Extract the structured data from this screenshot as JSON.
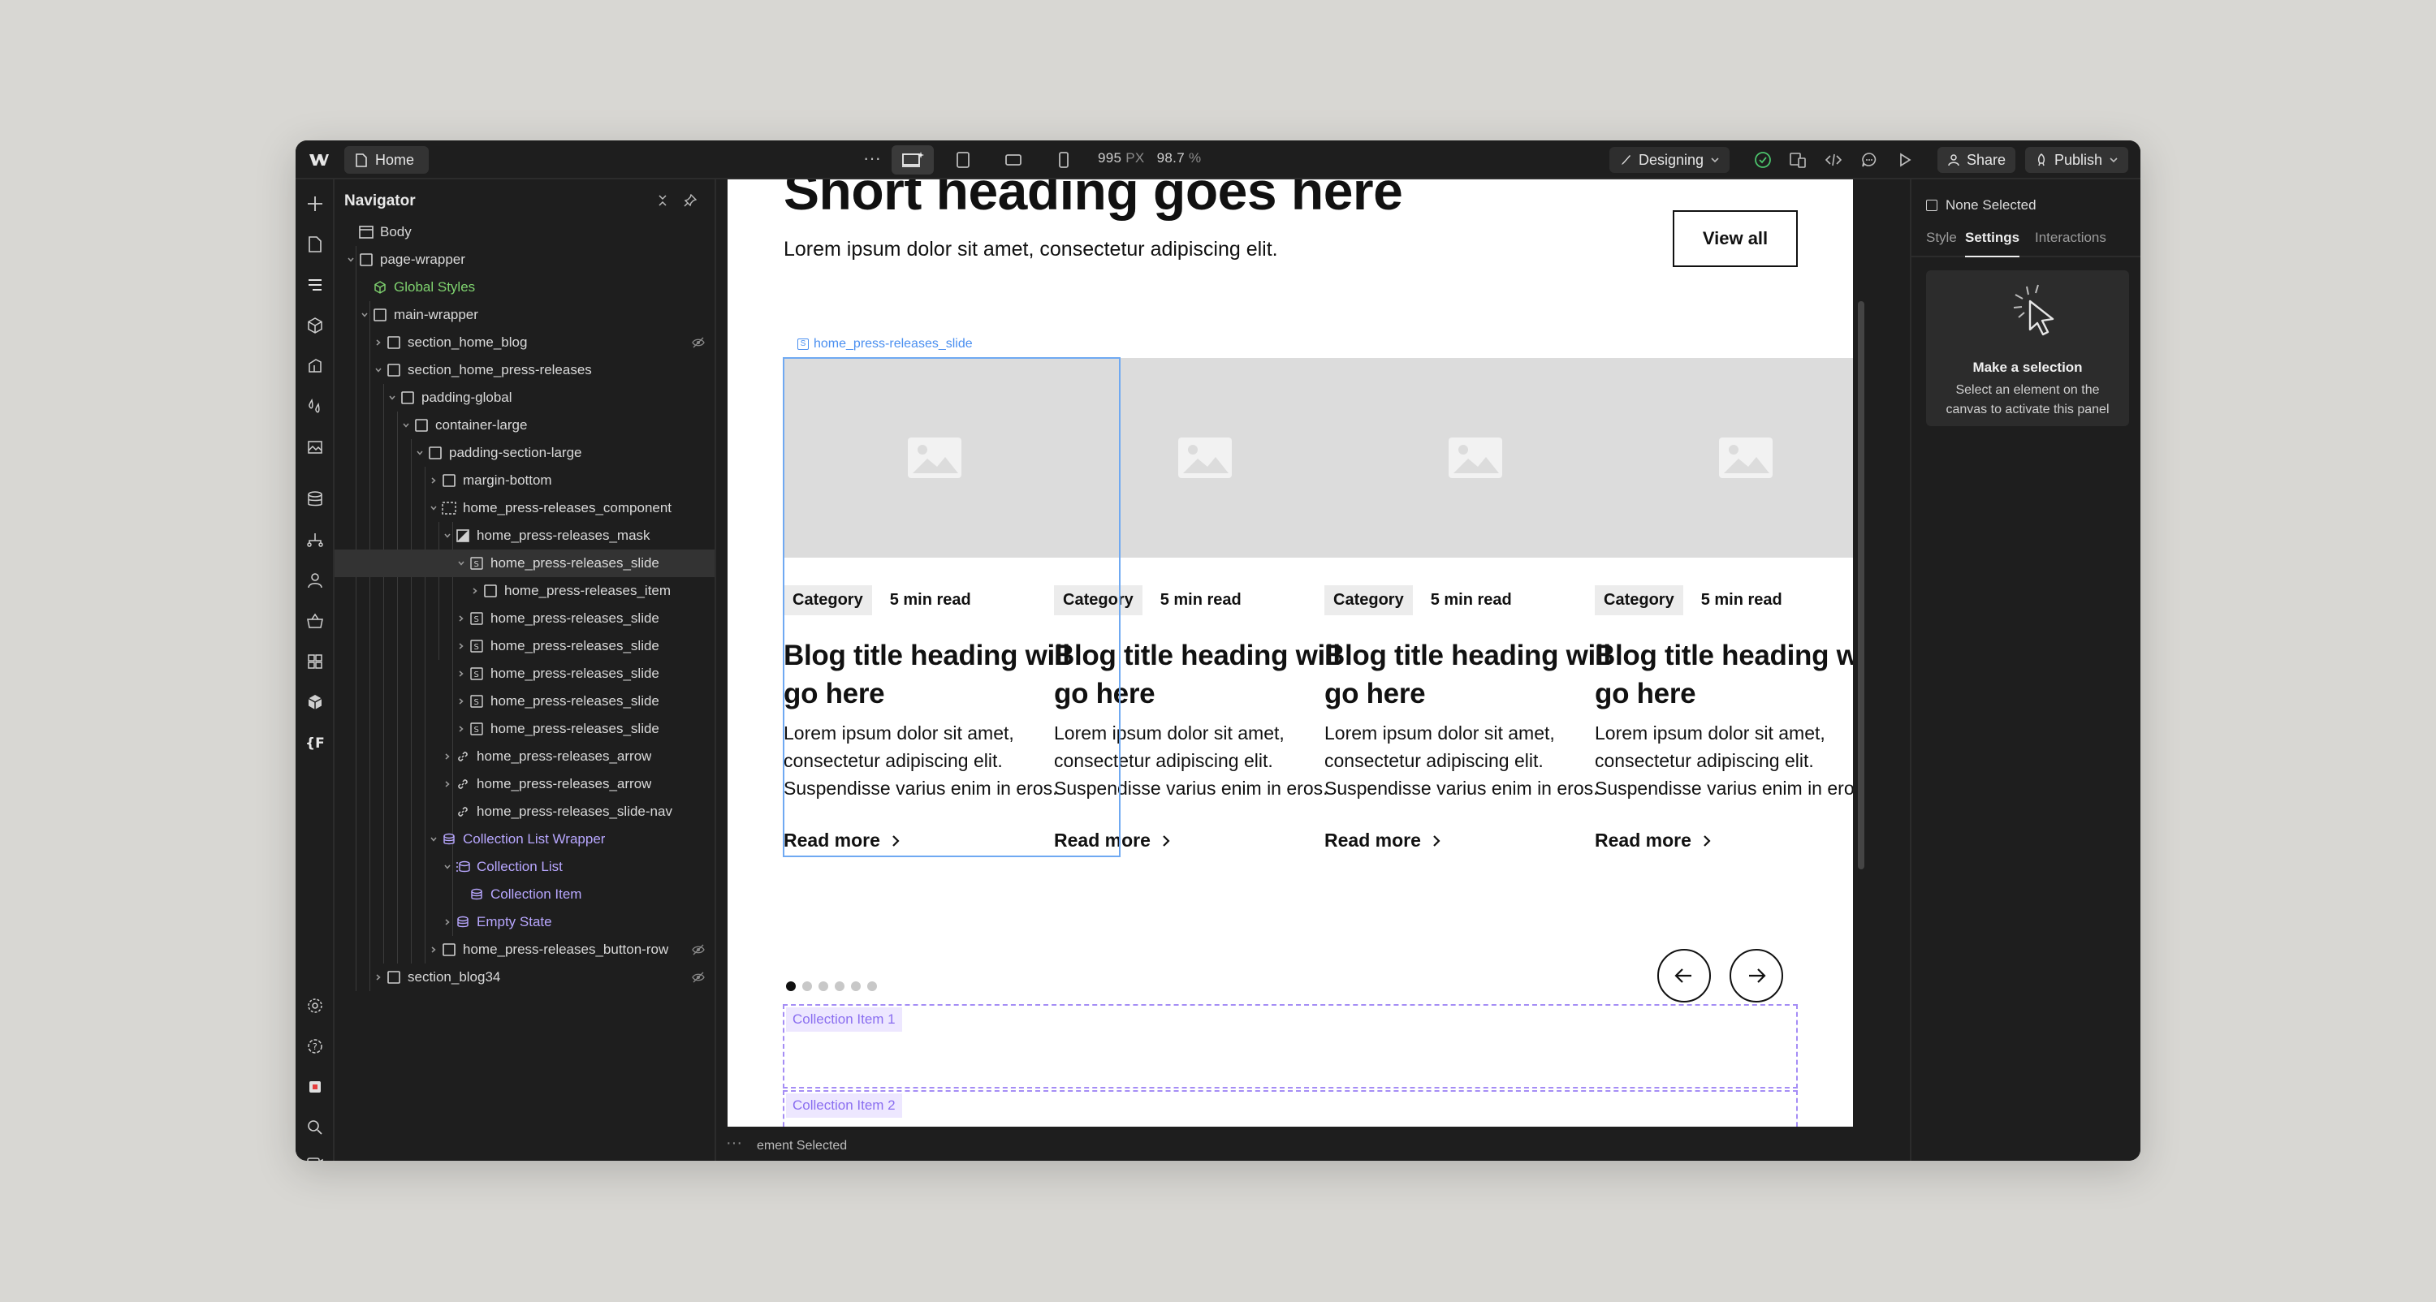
{
  "topbar": {
    "page_name": "Home",
    "more": "···",
    "width_value": "995",
    "width_unit": "PX",
    "zoom": "98.7",
    "zoom_unit": "%",
    "mode": "Designing",
    "share": "Share",
    "publish": "Publish"
  },
  "navigator": {
    "title": "Navigator",
    "items": [
      {
        "label": "Body"
      },
      {
        "label": "page-wrapper"
      },
      {
        "label": "Global Styles"
      },
      {
        "label": "main-wrapper"
      },
      {
        "label": "section_home_blog"
      },
      {
        "label": "section_home_press-releases"
      },
      {
        "label": "padding-global"
      },
      {
        "label": "container-large"
      },
      {
        "label": "padding-section-large"
      },
      {
        "label": "margin-bottom"
      },
      {
        "label": "home_press-releases_component"
      },
      {
        "label": "home_press-releases_mask"
      },
      {
        "label": "home_press-releases_slide"
      },
      {
        "label": "home_press-releases_item"
      },
      {
        "label": "home_press-releases_slide"
      },
      {
        "label": "home_press-releases_slide"
      },
      {
        "label": "home_press-releases_slide"
      },
      {
        "label": "home_press-releases_slide"
      },
      {
        "label": "home_press-releases_slide"
      },
      {
        "label": "home_press-releases_arrow"
      },
      {
        "label": "home_press-releases_arrow"
      },
      {
        "label": "home_press-releases_slide-nav"
      },
      {
        "label": "Collection List Wrapper"
      },
      {
        "label": "Collection List"
      },
      {
        "label": "Collection Item"
      },
      {
        "label": "Empty State"
      },
      {
        "label": "home_press-releases_button-row"
      },
      {
        "label": "section_blog34"
      }
    ]
  },
  "canvas": {
    "heading": "Short heading goes here",
    "subheading": "Lorem ipsum dolor sit amet, consectetur adipiscing elit.",
    "view_all": "View all",
    "selection_tag": "home_press-releases_slide",
    "cards": [
      {
        "tag": "Category",
        "read": "5 min read",
        "title": "Blog title heading will go here",
        "desc": "Lorem ipsum dolor sit amet, consectetur adipiscing elit. Suspendisse varius enim in eros.",
        "more": "Read more"
      },
      {
        "tag": "Category",
        "read": "5 min read",
        "title": "Blog title heading will go here",
        "desc": "Lorem ipsum dolor sit amet, consectetur adipiscing elit. Suspendisse varius enim in eros.",
        "more": "Read more"
      },
      {
        "tag": "Category",
        "read": "5 min read",
        "title": "Blog title heading will go here",
        "desc": "Lorem ipsum dolor sit amet, consectetur adipiscing elit. Suspendisse varius enim in eros.",
        "more": "Read more"
      },
      {
        "tag": "Category",
        "read": "5 min read",
        "title": "Blog title heading will go here",
        "desc": "Lorem ipsum dolor sit amet, consectetur adipiscing elit. Suspendisse varius enim in eros.",
        "more": "Read more"
      }
    ],
    "collection_item_1": "Collection Item 1",
    "collection_item_2": "Collection Item 2",
    "active_dot": 1,
    "dot_count": 6
  },
  "status_bar": {
    "text": "ement Selected"
  },
  "right_panel": {
    "none_selected": "None Selected",
    "tabs": [
      "Style",
      "Settings",
      "Interactions"
    ],
    "active_tab": "Settings",
    "prompt_title": "Make a selection",
    "prompt_text": "Select an element on the canvas to activate this panel"
  },
  "colors": {
    "accent_blue": "#6fa9f2",
    "collection_purple": "#a58df5",
    "global_styles_green": "#7fd36f",
    "publish_indicator": "#4cc36c"
  }
}
